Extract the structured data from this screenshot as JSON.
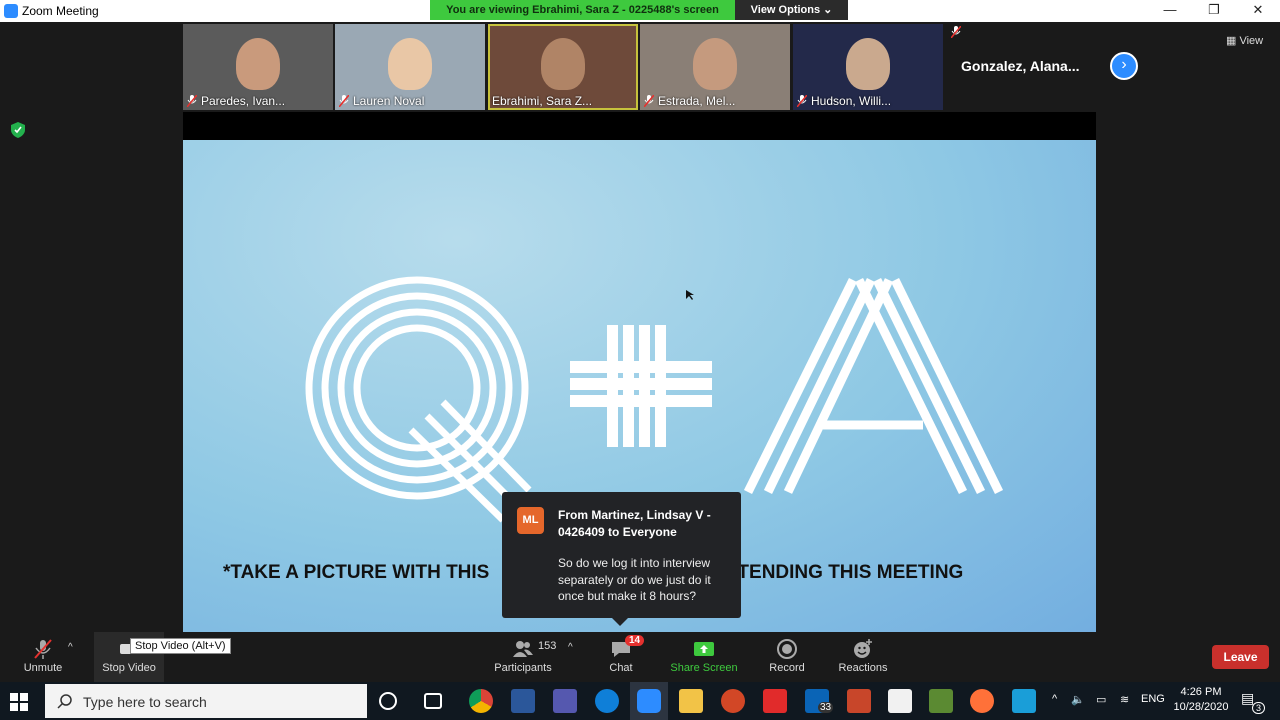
{
  "window": {
    "title": "Zoom Meeting",
    "minimize": "—",
    "restore": "❐",
    "close": "✕"
  },
  "share_banner": {
    "text": "You are viewing Ebrahimi, Sara Z - 0225488's screen",
    "view_options": "View Options ⌄"
  },
  "gallery": {
    "participants": [
      {
        "name": "Paredes, Ivan...",
        "muted": true,
        "skin": "#c99a7c",
        "bg": "#5b5b5b"
      },
      {
        "name": "Lauren Noval",
        "muted": true,
        "skin": "#e9c7a6",
        "bg": "#9aa8b4"
      },
      {
        "name": "Ebrahimi, Sara Z...",
        "muted": false,
        "skin": "#b08466",
        "bg": "#6e4a3a"
      },
      {
        "name": "Estrada, Mel...",
        "muted": true,
        "skin": "#c59a7e",
        "bg": "#8a7f76"
      },
      {
        "name": "Hudson, Willi...",
        "muted": true,
        "skin": "#caa98e",
        "bg": "#23294a"
      }
    ],
    "name_only": "Gonzalez,  Alana...",
    "next": "›",
    "view": "View"
  },
  "slide": {
    "bottom_text": "*TAKE A PICTURE WITH THIS                                  FOR ATTENDING THIS MEETING"
  },
  "chat_popup": {
    "avatar": "ML",
    "from": "From Martinez, Lindsay V - 0426409 to Everyone",
    "message": "So do we log it into interview separately or do we just do it once but make it 8 hours?"
  },
  "controls": {
    "unmute": "Unmute",
    "stop_video": "Stop Video",
    "tooltip": "Stop Video (Alt+V)",
    "participants": "Participants",
    "participant_count": "153",
    "chat": "Chat",
    "chat_badge": "14",
    "share_screen": "Share Screen",
    "record": "Record",
    "reactions": "Reactions",
    "leave": "Leave"
  },
  "taskbar": {
    "search_placeholder": "Type here to search",
    "mail_badge": "33",
    "lang": "ENG",
    "time": "4:26 PM",
    "date": "10/28/2020",
    "notif": "3"
  },
  "colors": {
    "accent": "#2d8cff",
    "share_green": "#3ec93e",
    "leave_red": "#c9302c",
    "badge_red": "#e5312e"
  }
}
